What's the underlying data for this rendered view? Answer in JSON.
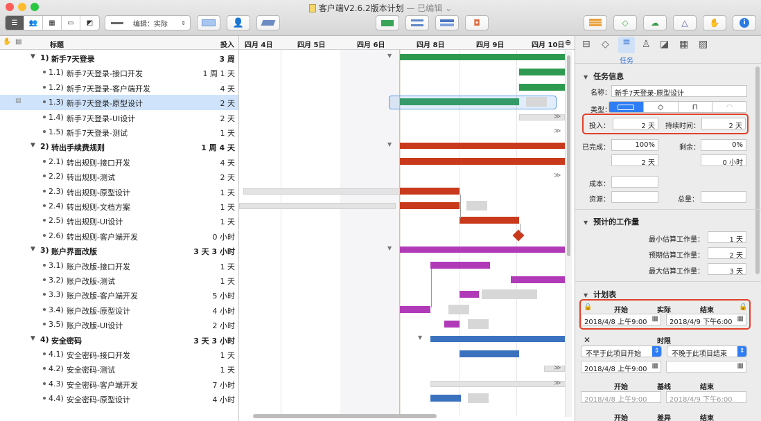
{
  "window": {
    "doc_title": "客户端V2.6.2版本计划",
    "edited_suffix": "— 已编辑 ⌄"
  },
  "toolbar": {
    "edit_mode_label": "编辑：实际"
  },
  "outline": {
    "col_title": "标题",
    "col_work": "投入",
    "rows": [
      {
        "num": "1)",
        "title": "新手7天登录",
        "work": "3 周",
        "level": 0,
        "summary": true
      },
      {
        "num": "1.1)",
        "title": "新手7天登录-接口开发",
        "work": "1 周 1 天",
        "level": 1
      },
      {
        "num": "1.2)",
        "title": "新手7天登录-客户端开发",
        "work": "4 天",
        "level": 1
      },
      {
        "num": "1.3)",
        "title": "新手7天登录-原型设计",
        "work": "2 天",
        "level": 1,
        "selected": true
      },
      {
        "num": "1.4)",
        "title": "新手7天登录-UI设计",
        "work": "2 天",
        "level": 1
      },
      {
        "num": "1.5)",
        "title": "新手7天登录-测试",
        "work": "1 天",
        "level": 1
      },
      {
        "num": "2)",
        "title": "转出手续费规则",
        "work": "1 周 4 天",
        "level": 0,
        "summary": true
      },
      {
        "num": "2.1)",
        "title": "转出规则-接口开发",
        "work": "4 天",
        "level": 1
      },
      {
        "num": "2.2)",
        "title": "转出规则-测试",
        "work": "2 天",
        "level": 1
      },
      {
        "num": "2.3)",
        "title": "转出规则-原型设计",
        "work": "1 天",
        "level": 1
      },
      {
        "num": "2.4)",
        "title": "转出规则-文档方案",
        "work": "1 天",
        "level": 1
      },
      {
        "num": "2.5)",
        "title": "转出规则-UI设计",
        "work": "1 天",
        "level": 1
      },
      {
        "num": "2.6)",
        "title": "转出规则-客户端开发",
        "work": "0 小时",
        "level": 1,
        "milestone": true
      },
      {
        "num": "3)",
        "title": "账户界面改版",
        "work": "3 天 3 小时",
        "level": 0,
        "summary": true
      },
      {
        "num": "3.1)",
        "title": "账户改版-接口开发",
        "work": "1 天",
        "level": 1
      },
      {
        "num": "3.2)",
        "title": "账户改版-测试",
        "work": "1 天",
        "level": 1
      },
      {
        "num": "3.3)",
        "title": "账户改版-客户端开发",
        "work": "5 小时",
        "level": 1
      },
      {
        "num": "3.4)",
        "title": "账户改版-原型设计",
        "work": "4 小时",
        "level": 1
      },
      {
        "num": "3.5)",
        "title": "账户改版-UI设计",
        "work": "2 小时",
        "level": 1
      },
      {
        "num": "4)",
        "title": "安全密码",
        "work": "3 天 3 小时",
        "level": 0,
        "summary": true
      },
      {
        "num": "4.1)",
        "title": "安全密码-接口开发",
        "work": "1 天",
        "level": 1
      },
      {
        "num": "4.2)",
        "title": "安全密码-测试",
        "work": "1 天",
        "level": 1
      },
      {
        "num": "4.3)",
        "title": "安全密码-客户端开发",
        "work": "7 小时",
        "level": 1
      },
      {
        "num": "4.4)",
        "title": "安全密码-原型设计",
        "work": "4 小时",
        "level": 1
      }
    ]
  },
  "gantt": {
    "dates": [
      "四月 4日",
      "四月 5日",
      "四月 6日",
      "四月 8日",
      "四月 9日",
      "四月 10日"
    ]
  },
  "inspector": {
    "tab_label": "任务",
    "task_info": {
      "section": "任务信息",
      "name_label": "名称：",
      "name_value": "新手7天登录-原型设计",
      "type_label": "类型：",
      "effort_label": "投入：",
      "effort_value": "2 天",
      "duration_label": "持续时间：",
      "duration_value": "2 天",
      "complete_label": "已完成：",
      "complete_value": "100%",
      "remaining_label": "剩余：",
      "remaining_value": "0%",
      "done_work": "2 天",
      "remaining_work": "0 小时",
      "cost_label": "成本：",
      "resource_label": "资源：",
      "total_label": "总量："
    },
    "estimate": {
      "section": "预计的工作量",
      "min_label": "最小估算工作量：",
      "min_value": "1 天",
      "expected_label": "预期估算工作量：",
      "expected_value": "2 天",
      "max_label": "最大估算工作量：",
      "max_value": "3 天"
    },
    "schedule": {
      "section": "计划表",
      "start_label": "开始",
      "actual_label": "实际",
      "end_label": "结束",
      "start_value": "2018/4/8 上午9:00",
      "end_value": "2018/4/9 下午6:00",
      "deadline_label": "时限",
      "start_constraint": "不早于此项目开始",
      "end_constraint": "不晚于此项目结束",
      "constraint_date": "2018/4/8 上午9:00",
      "baseline_label": "基线",
      "baseline_start": "2018/4/8 上午9:00",
      "baseline_end": "2018/4/9 下午6:00",
      "variance_label": "差异"
    }
  }
}
